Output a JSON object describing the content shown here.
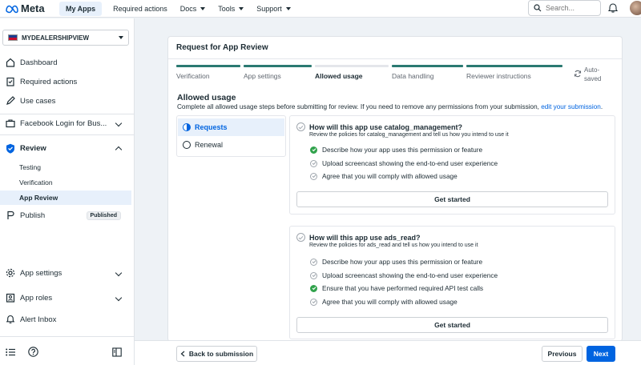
{
  "topbar": {
    "logo": "Meta",
    "nav": [
      "My Apps",
      "Required actions",
      "Docs",
      "Tools",
      "Support"
    ],
    "search_placeholder": "Search..."
  },
  "sidebar": {
    "app_name": "MYDEALERSHIPVIEW",
    "items": {
      "dashboard": "Dashboard",
      "required_actions": "Required actions",
      "use_cases": "Use cases",
      "facebook_login": "Facebook Login for Bus...",
      "review": "Review",
      "testing": "Testing",
      "verification": "Verification",
      "app_review": "App Review",
      "publish": "Publish",
      "published_badge": "Published",
      "app_settings": "App settings",
      "app_roles": "App roles",
      "alert_inbox": "Alert Inbox"
    }
  },
  "card": {
    "title": "Request for App Review",
    "steps": [
      {
        "label": "Verification",
        "state": "complete"
      },
      {
        "label": "App settings",
        "state": "complete"
      },
      {
        "label": "Allowed usage",
        "state": "current"
      },
      {
        "label": "Data handling",
        "state": "complete"
      },
      {
        "label": "Reviewer instructions",
        "state": "complete"
      }
    ],
    "autosaved": [
      "Auto-",
      "saved"
    ],
    "section_title": "Allowed usage",
    "section_desc": "Complete all allowed usage steps before submitting for review. If you need to remove any permissions from your submission,",
    "section_link": "edit your submission",
    "tabs": [
      "Requests",
      "Renewal"
    ],
    "permissions": [
      {
        "title": "How will this app use catalog_management?",
        "subtitle": "Review the policies for catalog_management and tell us how you intend to use it",
        "requirements": [
          {
            "text": "Describe how your app uses this permission or feature",
            "done": true
          },
          {
            "text": "Upload screencast showing the end-to-end user experience",
            "done": false
          },
          {
            "text": "Agree that you will comply with allowed usage",
            "done": false
          }
        ],
        "button": "Get started"
      },
      {
        "title": "How will this app use ads_read?",
        "subtitle": "Review the policies for ads_read and tell us how you intend to use it",
        "requirements": [
          {
            "text": "Describe how your app uses this permission or feature",
            "done": false
          },
          {
            "text": "Upload screencast showing the end-to-end user experience",
            "done": false
          },
          {
            "text": "Ensure that you have performed required API test calls",
            "done": true
          },
          {
            "text": "Agree that you will comply with allowed usage",
            "done": false
          }
        ],
        "button": "Get started"
      }
    ]
  },
  "footer": {
    "back": "Back to submission",
    "previous": "Previous",
    "next": "Next"
  }
}
